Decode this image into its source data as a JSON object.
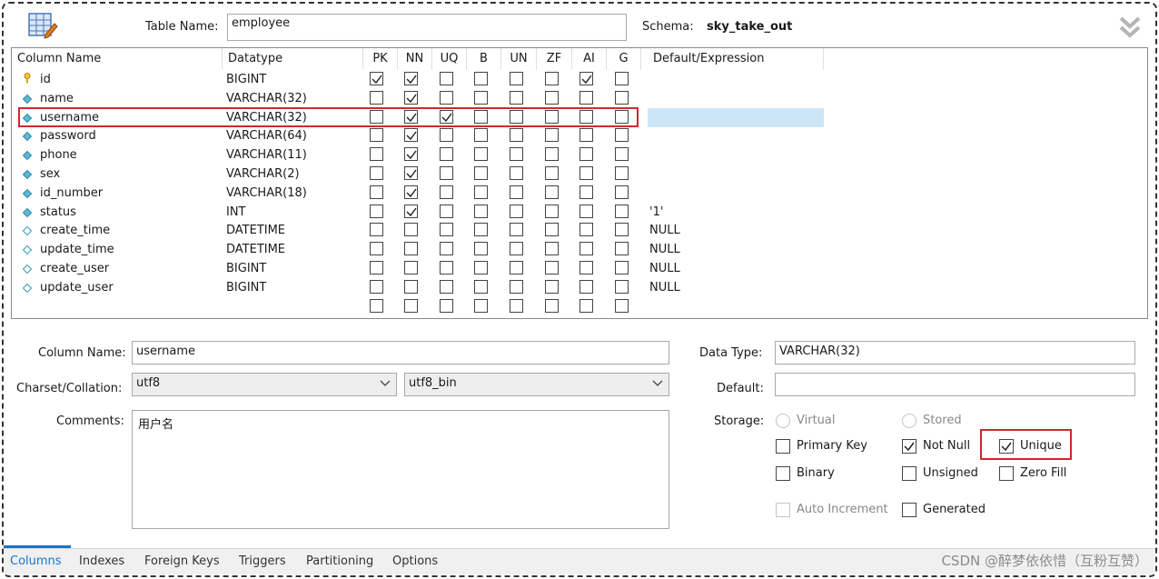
{
  "header": {
    "table_name_label": "Table Name:",
    "table_name_value": "employee",
    "schema_label": "Schema:",
    "schema_value": "sky_take_out"
  },
  "grid": {
    "headers": [
      "Column Name",
      "Datatype",
      "PK",
      "NN",
      "UQ",
      "B",
      "UN",
      "ZF",
      "AI",
      "G",
      "Default/Expression"
    ],
    "rows": [
      {
        "name": "id",
        "type": "BIGINT",
        "icon": "primary-key-icon",
        "flags": [
          1,
          1,
          0,
          0,
          0,
          0,
          1,
          0
        ],
        "default": ""
      },
      {
        "name": "name",
        "type": "VARCHAR(32)",
        "icon": "column-nn-icon",
        "flags": [
          0,
          1,
          0,
          0,
          0,
          0,
          0,
          0
        ],
        "default": ""
      },
      {
        "name": "username",
        "type": "VARCHAR(32)",
        "icon": "column-nn-icon",
        "flags": [
          0,
          1,
          1,
          0,
          0,
          0,
          0,
          0
        ],
        "default": "",
        "selected": true
      },
      {
        "name": "password",
        "type": "VARCHAR(64)",
        "icon": "column-nn-icon",
        "flags": [
          0,
          1,
          0,
          0,
          0,
          0,
          0,
          0
        ],
        "default": ""
      },
      {
        "name": "phone",
        "type": "VARCHAR(11)",
        "icon": "column-nn-icon",
        "flags": [
          0,
          1,
          0,
          0,
          0,
          0,
          0,
          0
        ],
        "default": ""
      },
      {
        "name": "sex",
        "type": "VARCHAR(2)",
        "icon": "column-nn-icon",
        "flags": [
          0,
          1,
          0,
          0,
          0,
          0,
          0,
          0
        ],
        "default": ""
      },
      {
        "name": "id_number",
        "type": "VARCHAR(18)",
        "icon": "column-nn-icon",
        "flags": [
          0,
          1,
          0,
          0,
          0,
          0,
          0,
          0
        ],
        "default": ""
      },
      {
        "name": "status",
        "type": "INT",
        "icon": "column-nn-icon",
        "flags": [
          0,
          1,
          0,
          0,
          0,
          0,
          0,
          0
        ],
        "default": "'1'"
      },
      {
        "name": "create_time",
        "type": "DATETIME",
        "icon": "column-null-icon",
        "flags": [
          0,
          0,
          0,
          0,
          0,
          0,
          0,
          0
        ],
        "default": "NULL"
      },
      {
        "name": "update_time",
        "type": "DATETIME",
        "icon": "column-null-icon",
        "flags": [
          0,
          0,
          0,
          0,
          0,
          0,
          0,
          0
        ],
        "default": "NULL"
      },
      {
        "name": "create_user",
        "type": "BIGINT",
        "icon": "column-null-icon",
        "flags": [
          0,
          0,
          0,
          0,
          0,
          0,
          0,
          0
        ],
        "default": "NULL"
      },
      {
        "name": "update_user",
        "type": "BIGINT",
        "icon": "column-null-icon",
        "flags": [
          0,
          0,
          0,
          0,
          0,
          0,
          0,
          0
        ],
        "default": "NULL"
      },
      {
        "name": "",
        "type": "",
        "icon": "",
        "flags": [
          0,
          0,
          0,
          0,
          0,
          0,
          0,
          0
        ],
        "default": ""
      }
    ]
  },
  "details": {
    "column_name_label": "Column Name:",
    "column_name_value": "username",
    "charset_label": "Charset/Collation:",
    "charset_value": "utf8",
    "collation_value": "utf8_bin",
    "comments_label": "Comments:",
    "comments_value": "用户名",
    "data_type_label": "Data Type:",
    "data_type_value": "VARCHAR(32)",
    "default_label": "Default:",
    "default_value": "",
    "storage_label": "Storage:",
    "virtual": "Virtual",
    "stored": "Stored",
    "primary_key": "Primary Key",
    "not_null": "Not Null",
    "unique": "Unique",
    "binary": "Binary",
    "unsigned": "Unsigned",
    "zero_fill": "Zero Fill",
    "auto_increment": "Auto Increment",
    "generated": "Generated"
  },
  "tabs": [
    "Columns",
    "Indexes",
    "Foreign Keys",
    "Triggers",
    "Partitioning",
    "Options"
  ],
  "watermark": "CSDN @醉梦依依惜（互粉互赞）",
  "colors": {
    "accent": "#1a73c8",
    "highlight": "#d0282e",
    "selection": "#cde6f7"
  }
}
